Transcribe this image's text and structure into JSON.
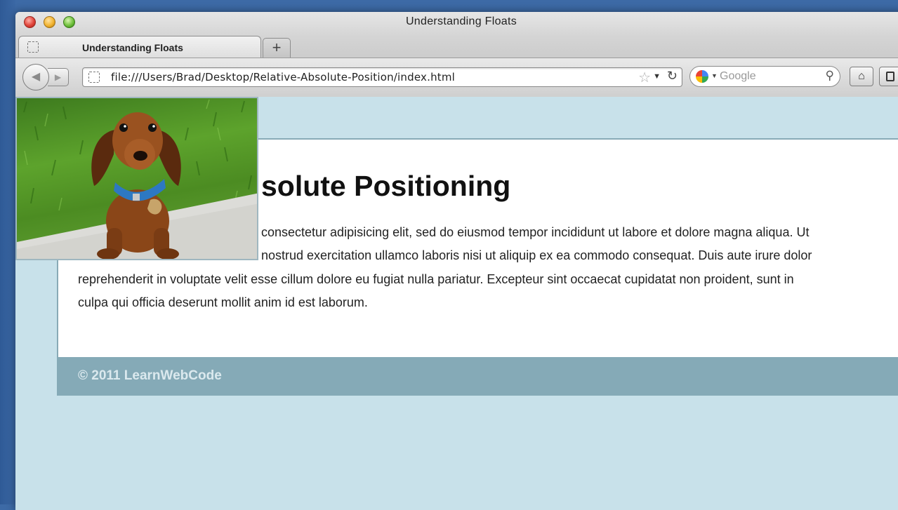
{
  "window": {
    "title": "Understanding Floats"
  },
  "tabs": [
    {
      "label": "Understanding Floats"
    }
  ],
  "toolbar": {
    "new_tab_label": "+",
    "url": "file:///Users/Brad/Desktop/Relative-Absolute-Position/index.html",
    "search_placeholder": "Google",
    "back_icon": "back-arrow-icon",
    "forward_icon": "forward-arrow-icon",
    "home_icon": "home-icon"
  },
  "page": {
    "heading": "solute Positioning",
    "paragraph_lines": [
      "consectetur adipisicing elit, sed do eiusmod tempor incididunt ut labore et dolore magna aliqua. Ut",
      "nostrud exercitation ullamco laboris nisi ut aliquip ex ea commodo consequat. Duis aute irure dolor",
      "reprehenderit in voluptate velit esse cillum dolore eu fugiat nulla pariatur. Excepteur sint occaecat cupidatat non proident, sunt in",
      "culpa qui officia deserunt mollit anim id est laborum."
    ],
    "footer": "© 2011 LearnWebCode",
    "image": "dachshund-photo"
  },
  "colors": {
    "page_background": "#c8e1ea",
    "footer_background": "#85aab7",
    "content_background": "#ffffff"
  }
}
